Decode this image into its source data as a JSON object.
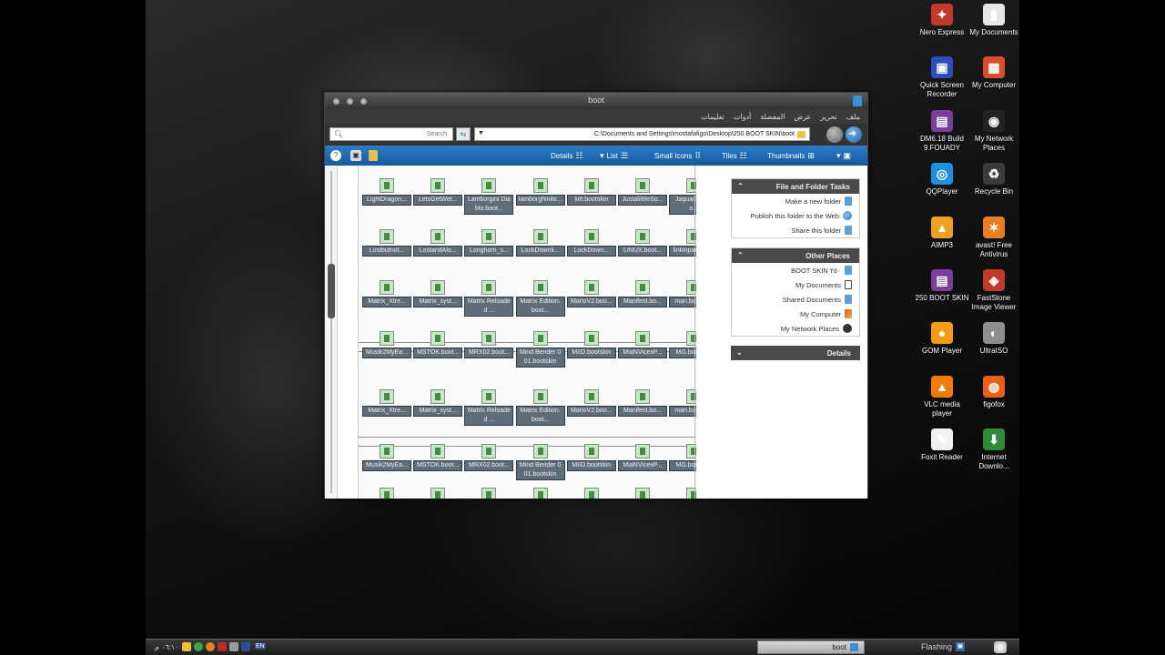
{
  "desktop_icons": [
    {
      "label": "Nero Express",
      "icon": "nero-icon",
      "color": "#c0392b",
      "glyph": "✦"
    },
    {
      "label": "My Documents",
      "icon": "documents-icon",
      "color": "#e6e6e6",
      "glyph": "▮"
    },
    {
      "label": "Quick Screen Recorder",
      "icon": "recorder-icon",
      "color": "#2a4fb8",
      "glyph": "▣"
    },
    {
      "label": "My Computer",
      "icon": "computer-icon",
      "color": "#d94e2a",
      "glyph": "▦"
    },
    {
      "label": "DM6.18 Build 9.FOUADY",
      "icon": "winrar-icon",
      "color": "#7b3e9a",
      "glyph": "▤"
    },
    {
      "label": "My Network Places",
      "icon": "network-icon",
      "color": "#222",
      "glyph": "◉"
    },
    {
      "label": "QQPlayer",
      "icon": "qqplayer-icon",
      "color": "#1f8fe0",
      "glyph": "◎"
    },
    {
      "label": "Recycle Bin",
      "icon": "recycle-bin-icon",
      "color": "#3a3a3a",
      "glyph": "♻"
    },
    {
      "label": "AIMP3",
      "icon": "aimp-icon",
      "color": "#f0a020",
      "glyph": "▲"
    },
    {
      "label": "avast! Free Antivirus",
      "icon": "avast-icon",
      "color": "#e67e22",
      "glyph": "✶"
    },
    {
      "label": "250 BOOT SKIN",
      "icon": "winrar-icon",
      "color": "#7b3e9a",
      "glyph": "▤"
    },
    {
      "label": "FastStone Image Viewer",
      "icon": "faststone-icon",
      "color": "#c0392b",
      "glyph": "◈"
    },
    {
      "label": "GOM Player",
      "icon": "gom-icon",
      "color": "#f39c12",
      "glyph": "●"
    },
    {
      "label": "UltraISO",
      "icon": "ultraiso-icon",
      "color": "#8e8e8e",
      "glyph": "◐"
    },
    {
      "label": "VLC media player",
      "icon": "vlc-icon",
      "color": "#f07d00",
      "glyph": "▲"
    },
    {
      "label": "figofox",
      "icon": "firefox-icon",
      "color": "#e8601c",
      "glyph": "◍"
    },
    {
      "label": "Foxit Reader",
      "icon": "foxit-icon",
      "color": "#f0f0f0",
      "glyph": "✎"
    },
    {
      "label": "Internet Downlo...",
      "icon": "idm-icon",
      "color": "#2c8a3a",
      "glyph": "⬇"
    }
  ],
  "window": {
    "title": "boot",
    "menu": [
      "ملف",
      "تحرير",
      "عرض",
      "المفضلة",
      "أدوات",
      "تعليمات"
    ],
    "search_placeholder": "Search",
    "address": "C:\\Documents and Settings\\mostafafigo\\Desktop\\250 BOOT SKIN\\boot",
    "views": {
      "thumbnails": "Thumbnails",
      "tiles": "Tiles",
      "small_icons": "Small Icons",
      "list": "List",
      "details": "Details"
    }
  },
  "files": [
    [
      "LightDragon...",
      "LetsGetWet...",
      "Lamborgini Diablo.boot...",
      "lamborghinilo...",
      "kitt.bootskin",
      "JustaliittleSo...",
      "JaguarXK.boo..."
    ],
    [
      "Lostbutnot...",
      "LostandAlo...",
      "Longhorn_s...",
      "LockDownli...",
      "LockDown...",
      "LINUX.boot...",
      "linkinpark.bo..."
    ],
    [
      "Matrix_Xtre...",
      "Matrix_syst...",
      "Matrix Reloaded ...",
      "Matrix Edition.boot...",
      "MarioV2.boo...",
      "Manifest.bo...",
      "man.bootskin"
    ],
    [
      "Musik2MyEa...",
      "MSTOK.boot...",
      "MRX02.boot...",
      "Mind Bender 001.bootskin",
      "MIID.bootskin",
      "MiaNVicexP...",
      "MG.bootskin"
    ],
    [
      "Matrix_Xtre...",
      "Matrix_syst...",
      "Matrix Reloaded ...",
      "Matrix Edition.boot...",
      "MarioV2.boo...",
      "Manifest.bo...",
      "man.bootskin"
    ],
    [
      "Musik2MyEa...",
      "MSTOK.boot...",
      "MRX02.boot...",
      "Mind Bender 001.bootskin",
      "MIID.bootskin",
      "MiaNVicexP...",
      "MG.bootskin"
    ]
  ],
  "tasks": {
    "file_folder": {
      "title": "File and Folder Tasks",
      "items": [
        "Make a new folder",
        "Publish this folder to the Web",
        "Share this folder"
      ]
    },
    "other_places": {
      "title": "Other Places",
      "items": [
        "BOOT SKIN ٢٥٠",
        "My Documents",
        "Shared Documents",
        "My Computer",
        "My Network Places"
      ]
    },
    "details": {
      "title": "Details"
    }
  },
  "taskbar": {
    "clock": "٠٦:١٠ م",
    "lang": "EN",
    "active_window": "boot",
    "flashing_label": "Flashing"
  }
}
